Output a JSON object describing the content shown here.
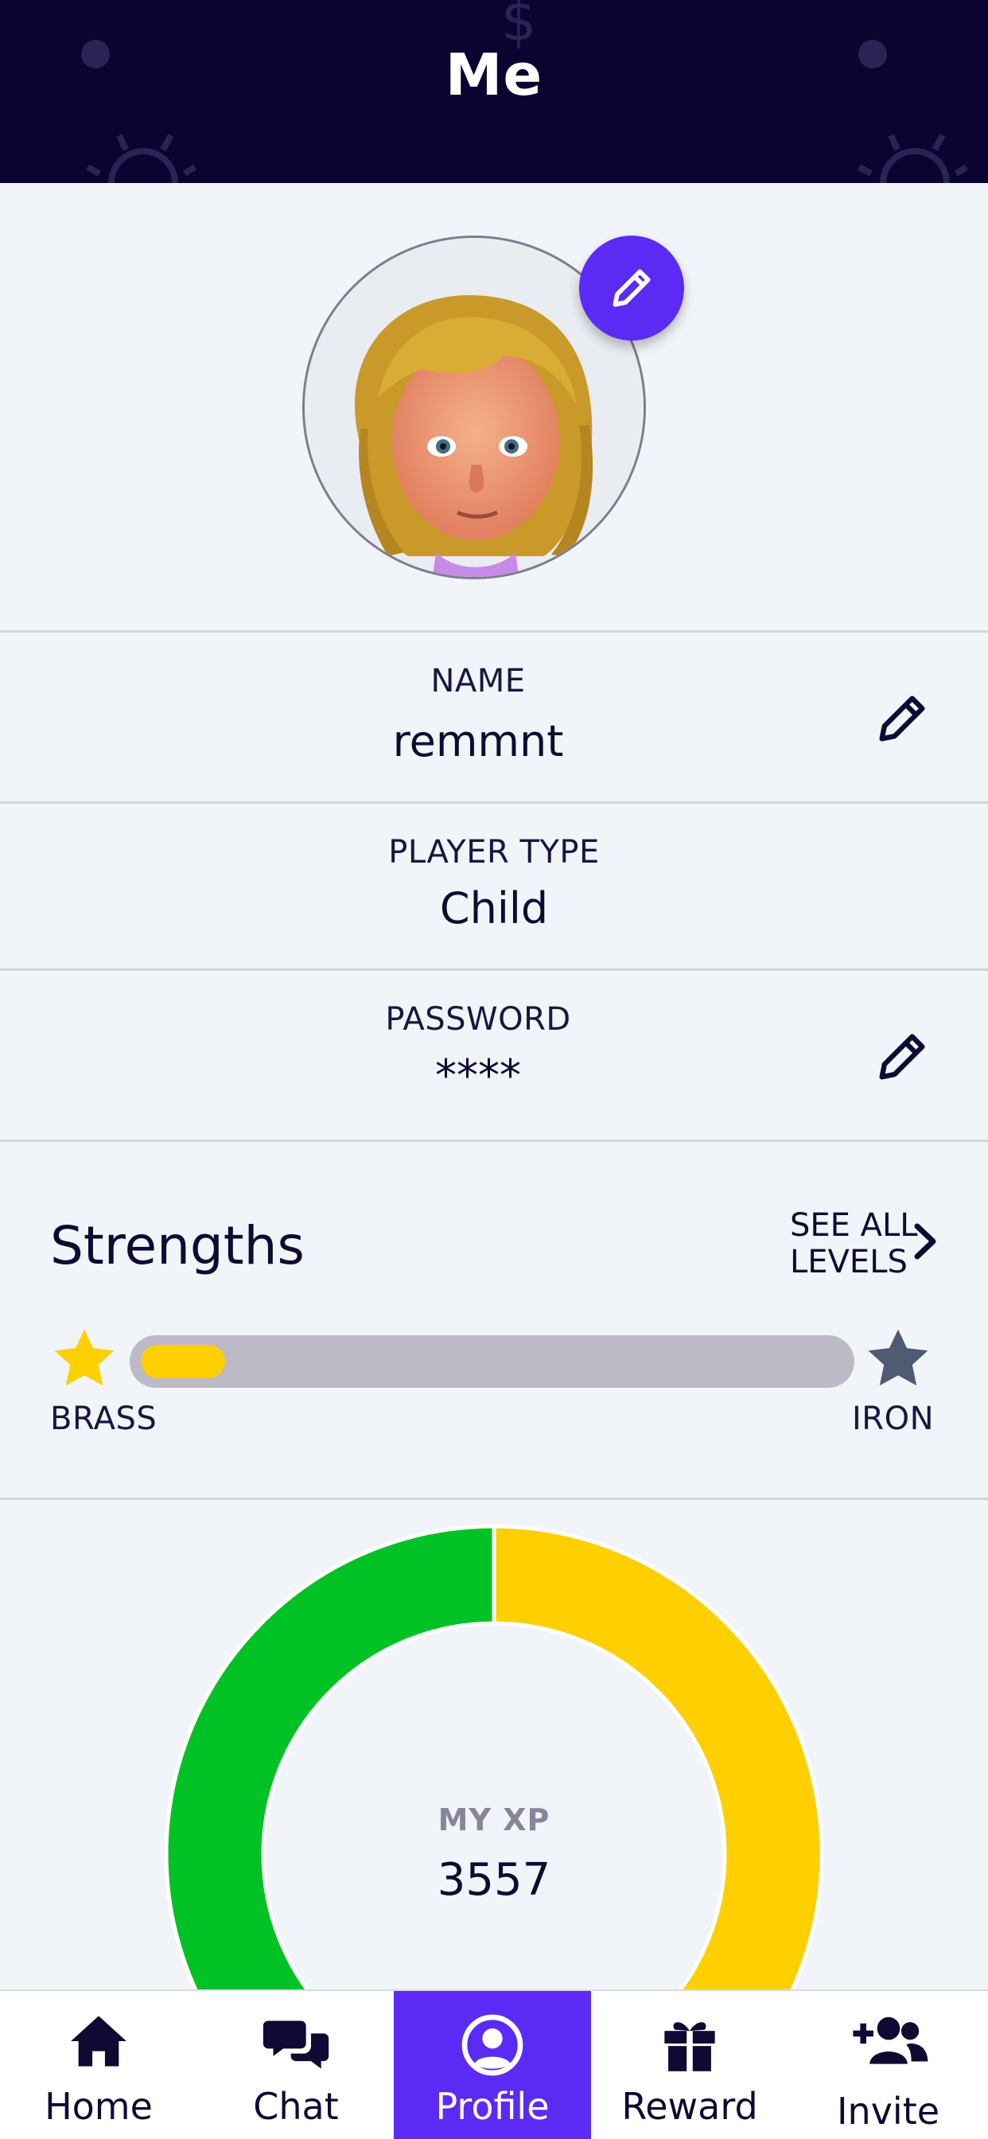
{
  "header": {
    "title": "Me"
  },
  "profile": {
    "name": {
      "label": "NAME",
      "value": "remmnt"
    },
    "player_type": {
      "label": "PLAYER TYPE",
      "value": "Child"
    },
    "password": {
      "label": "PASSWORD",
      "value": "****"
    }
  },
  "strengths": {
    "title": "Strengths",
    "see_all_line1": "SEE ALL",
    "see_all_line2": "LEVELS",
    "current_level": "BRASS",
    "next_level": "IRON",
    "progress_fraction": 0.12
  },
  "xp": {
    "label": "MY XP",
    "value": "3557",
    "segments": [
      {
        "name": "yellow",
        "color": "#ffcf00",
        "fraction": 0.5
      },
      {
        "name": "green",
        "color": "#00c224",
        "fraction": 0.5
      }
    ]
  },
  "tabs": [
    {
      "label": "Home",
      "icon": "home-icon",
      "active": false
    },
    {
      "label": "Chat",
      "icon": "chat-icon",
      "active": false
    },
    {
      "label": "Profile",
      "icon": "profile-icon",
      "active": true
    },
    {
      "label": "Reward",
      "icon": "gift-icon",
      "active": false
    },
    {
      "label": "Invite",
      "icon": "add-user-icon",
      "active": false
    }
  ],
  "colors": {
    "header_bg": "#0b0430",
    "accent": "#5b2bf5",
    "gold": "#ffcf00",
    "iron_star": "#4f5b72"
  }
}
